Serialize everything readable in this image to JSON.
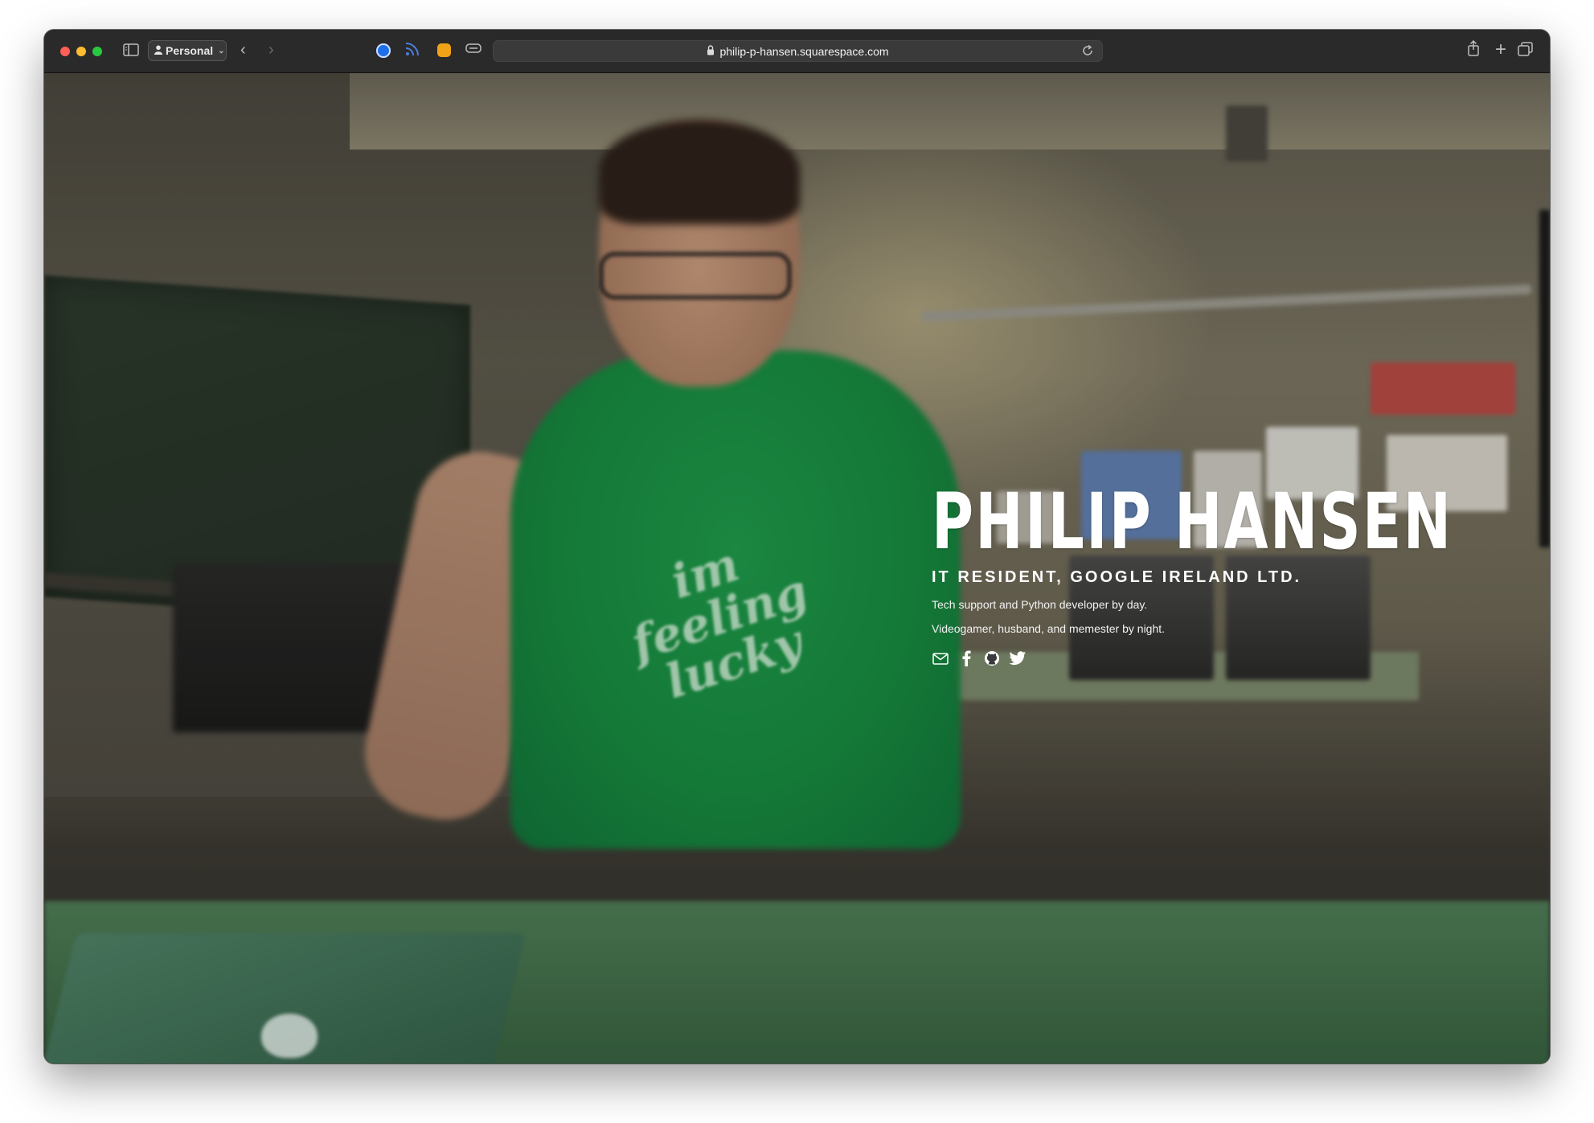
{
  "browser": {
    "profile_label": "Personal",
    "url": "philip-p-hansen.squarespace.com"
  },
  "hero": {
    "name": "PHILIP HANSEN",
    "title": "IT RESIDENT, GOOGLE IRELAND LTD.",
    "line1": "Tech support and Python developer by day.",
    "line2": "Videogamer, husband, and memester by night.",
    "shirt_text_1": "im feeling",
    "shirt_text_2": "lucky"
  },
  "social_icons": [
    "mail-icon",
    "facebook-icon",
    "github-icon",
    "twitter-icon"
  ],
  "colors": {
    "toolbar": "#2b2a2a",
    "shirt_green": "#178a3f",
    "hero_text": "#ffffff"
  }
}
